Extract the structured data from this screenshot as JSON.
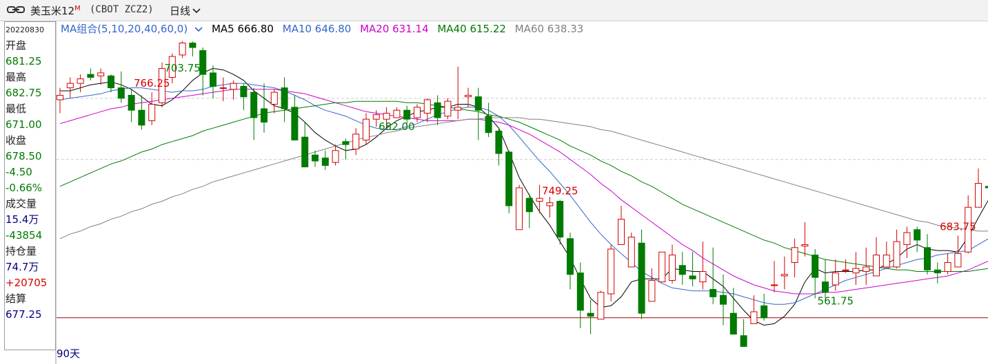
{
  "header": {
    "title": "美玉米12",
    "title_sup": "M",
    "code": "(CBOT ZCZ2)",
    "period": "日线"
  },
  "sidebar": {
    "date": "20220830",
    "open_label": "开盘",
    "open": "681.25",
    "high_label": "最高",
    "high": "682.75",
    "low_label": "最低",
    "low": "671.00",
    "close_label": "收盘",
    "close": "678.50",
    "change": "-4.50",
    "change_pct": "-0.66%",
    "volume_label": "成交量",
    "volume": "15.4万",
    "volume_change": "-43854",
    "oi_label": "持仓量",
    "oi": "74.7万",
    "oi_change": "+20705",
    "settle_label": "结算",
    "settle": "677.25"
  },
  "legend": {
    "group": "MA组合(5,10,20,40,60,0)",
    "ma5": "MA5 666.80",
    "ma10": "MA10 646.80",
    "ma20": "MA20 631.14",
    "ma40": "MA40 615.22",
    "ma60": "MA60 638.33"
  },
  "footer": {
    "days": "90天"
  },
  "colors": {
    "up": "#d40000",
    "down": "#007a00",
    "ma5": "#000000",
    "ma10": "#3366cc",
    "ma20": "#cc00cc",
    "ma40": "#007a00",
    "ma60": "#808080"
  },
  "chart_data": {
    "type": "candlestick",
    "ylim": [
      550,
      780
    ],
    "reference_levels": [
      728,
      687,
      581
    ],
    "annotations": [
      {
        "index": 9,
        "label": "766.25",
        "kind": "high"
      },
      {
        "index": 49,
        "label": "749.25",
        "kind": "high"
      },
      {
        "index": 12,
        "label": "703.75",
        "kind": "low"
      },
      {
        "index": 33,
        "label": "682.00",
        "kind": "low"
      },
      {
        "index": 76,
        "label": "561.75",
        "kind": "low"
      },
      {
        "index": 88,
        "label": "683.75",
        "kind": "high"
      }
    ],
    "candles": [
      [
        727,
        730,
        718,
        735
      ],
      [
        735,
        738,
        728,
        742
      ],
      [
        738,
        741,
        732,
        744
      ],
      [
        744,
        742,
        740,
        748
      ],
      [
        743,
        745,
        737,
        748
      ],
      [
        743,
        735,
        732,
        744
      ],
      [
        735,
        728,
        725,
        746
      ],
      [
        730,
        720,
        712,
        734
      ],
      [
        720,
        710,
        707,
        730
      ],
      [
        713,
        724,
        710,
        732
      ],
      [
        725,
        748,
        722,
        752
      ],
      [
        742,
        756,
        738,
        758
      ],
      [
        757,
        765,
        755,
        766.25
      ],
      [
        765,
        762,
        756,
        766
      ],
      [
        760,
        744,
        730,
        762
      ],
      [
        745,
        736,
        728,
        750
      ],
      [
        735,
        735,
        726,
        742
      ],
      [
        734,
        738,
        727,
        740
      ],
      [
        736,
        729,
        720,
        738
      ],
      [
        732,
        715,
        700,
        735
      ],
      [
        721,
        712,
        705,
        738
      ],
      [
        724,
        732,
        718,
        734
      ],
      [
        735,
        721,
        712,
        742
      ],
      [
        722,
        700,
        700,
        730
      ],
      [
        702,
        682,
        682,
        712
      ],
      [
        690,
        686,
        682,
        693
      ],
      [
        688,
        683,
        680,
        693
      ],
      [
        685,
        693,
        683,
        697
      ],
      [
        699,
        697,
        687,
        701
      ],
      [
        694,
        704,
        690,
        708
      ],
      [
        700,
        714,
        697,
        718
      ],
      [
        714,
        717,
        709,
        720
      ],
      [
        714,
        718,
        708,
        722
      ],
      [
        715,
        720,
        716,
        722
      ],
      [
        720,
        714,
        710,
        723
      ],
      [
        715,
        722,
        712,
        724
      ],
      [
        718,
        727,
        712,
        728
      ],
      [
        725,
        715,
        710,
        730
      ],
      [
        716,
        726,
        714,
        728
      ],
      [
        720,
        722,
        714,
        749.25
      ],
      [
        729,
        730,
        722,
        735
      ],
      [
        729,
        720,
        700,
        735
      ],
      [
        716,
        705,
        702,
        725
      ],
      [
        706,
        691,
        683,
        708
      ],
      [
        692,
        656,
        651,
        693
      ],
      [
        640,
        668,
        640,
        670
      ],
      [
        661,
        652,
        641,
        664
      ],
      [
        659,
        661,
        651,
        670
      ],
      [
        656,
        658,
        648,
        662
      ],
      [
        659,
        635,
        630,
        660
      ],
      [
        634,
        610,
        600,
        638
      ],
      [
        611,
        586,
        574,
        618
      ],
      [
        584,
        582,
        570,
        593
      ],
      [
        580,
        598,
        586,
        599
      ],
      [
        597,
        627,
        592,
        630
      ],
      [
        630,
        647,
        640,
        656
      ],
      [
        615,
        635,
        633,
        638
      ],
      [
        631,
        584,
        580,
        640
      ],
      [
        592,
        606,
        603,
        614
      ],
      [
        605,
        625,
        610,
        616
      ],
      [
        606,
        623,
        604,
        630
      ],
      [
        616,
        610,
        603,
        625
      ],
      [
        609,
        607,
        602,
        625
      ],
      [
        605,
        612,
        600,
        632
      ],
      [
        600,
        595,
        590,
        628
      ],
      [
        596,
        590,
        576,
        610
      ],
      [
        584,
        570,
        570,
        601
      ],
      [
        569,
        561.75,
        561.75,
        580
      ],
      [
        577,
        585,
        578,
        596
      ],
      [
        589,
        581,
        579,
        597
      ],
      [
        603,
        603,
        598,
        619
      ],
      [
        609,
        610,
        600,
        622
      ],
      [
        618,
        628,
        608,
        634
      ],
      [
        629,
        630,
        622,
        645
      ],
      [
        623,
        608,
        594,
        627
      ],
      [
        605,
        598,
        594,
        620
      ],
      [
        603,
        611,
        599,
        620
      ],
      [
        613,
        613,
        611,
        620
      ],
      [
        611,
        614,
        603,
        625
      ],
      [
        612,
        615,
        603,
        628
      ],
      [
        609,
        623,
        609,
        635
      ],
      [
        615,
        623,
        614,
        632
      ],
      [
        615,
        632,
        614,
        640
      ],
      [
        630,
        638,
        621,
        642
      ],
      [
        640,
        633,
        625,
        642
      ],
      [
        628,
        613,
        610,
        637
      ],
      [
        613,
        611,
        604,
        618
      ],
      [
        612,
        618,
        610,
        624
      ],
      [
        615,
        624,
        615,
        636
      ],
      [
        625,
        655,
        624,
        663
      ],
      [
        655,
        671,
        655,
        681
      ],
      [
        669,
        668,
        665,
        675
      ],
      [
        671,
        674,
        660,
        680
      ],
      [
        673,
        683.75,
        671,
        684
      ],
      [
        681.25,
        678.5,
        671,
        682.75
      ]
    ],
    "ma_series": [
      {
        "name": "MA5",
        "values": [
          733,
          733,
          735,
          737,
          738,
          739,
          737,
          734,
          729,
          724,
          723,
          727,
          733,
          740,
          745,
          748,
          747,
          744,
          740,
          733,
          728,
          723,
          721,
          718,
          712,
          705,
          700,
          696,
          693,
          694,
          697,
          702,
          708,
          713,
          716,
          719,
          720,
          722,
          722,
          724,
          724,
          722,
          716,
          708,
          692,
          675,
          663,
          652,
          643,
          632,
          621,
          607,
          594,
          588,
          589,
          595,
          605,
          607,
          607,
          607,
          614,
          613,
          612,
          612,
          607,
          602,
          594,
          586,
          579,
          576,
          577,
          582,
          590,
          605,
          614,
          611,
          612,
          612,
          612,
          613,
          613,
          617,
          621,
          627,
          630,
          627,
          626,
          626,
          625,
          635,
          648,
          660,
          668,
          667,
          666.8
        ]
      },
      {
        "name": "MA10",
        "values": [
          727,
          728,
          729,
          730,
          731,
          733,
          734,
          735,
          735,
          734,
          733,
          732,
          733,
          733,
          734,
          736,
          737,
          738,
          738,
          737,
          736,
          735,
          733,
          730,
          727,
          723,
          720,
          718,
          716,
          713,
          710,
          708,
          707,
          707,
          709,
          711,
          714,
          717,
          719,
          721,
          722,
          722,
          720,
          716,
          710,
          702,
          694,
          686,
          679,
          671,
          663,
          654,
          645,
          637,
          630,
          624,
          618,
          612,
          608,
          604,
          601,
          600,
          599,
          599,
          599,
          598,
          597,
          595,
          593,
          591,
          590,
          590,
          591,
          594,
          597,
          600,
          603,
          606,
          608,
          610,
          612,
          614,
          616,
          618,
          620,
          621,
          623,
          624,
          625,
          626,
          630,
          634,
          637,
          642,
          646.8
        ]
      },
      {
        "name": "MA20",
        "values": [
          711,
          713,
          715,
          717,
          719,
          721,
          722,
          724,
          725,
          726,
          727,
          728,
          729,
          730,
          731,
          732,
          733,
          734,
          734,
          734,
          734,
          734,
          733,
          732,
          731,
          729,
          727,
          725,
          723,
          721,
          719,
          718,
          717,
          716,
          715,
          714,
          713,
          713,
          713,
          713,
          714,
          714,
          713,
          712,
          710,
          707,
          704,
          700,
          696,
          692,
          687,
          682,
          677,
          671,
          666,
          660,
          655,
          650,
          645,
          640,
          635,
          630,
          626,
          621,
          617,
          613,
          609,
          606,
          603,
          601,
          599,
          598,
          597,
          597,
          597,
          598,
          598,
          599,
          600,
          601,
          602,
          603,
          604,
          605,
          606,
          607,
          608,
          609,
          611,
          613,
          616,
          619,
          623,
          627,
          631.14
        ]
      },
      {
        "name": "MA40",
        "values": [
          669,
          672,
          675,
          678,
          681,
          684,
          686,
          689,
          692,
          694,
          697,
          699,
          701,
          703,
          706,
          708,
          710,
          712,
          714,
          716,
          718,
          719,
          720,
          721,
          722,
          723,
          724,
          725,
          725,
          726,
          726,
          726,
          726,
          726,
          725,
          725,
          724,
          723,
          722,
          721,
          720,
          719,
          717,
          716,
          714,
          712,
          709,
          706,
          703,
          700,
          696,
          693,
          690,
          686,
          683,
          679,
          676,
          672,
          669,
          665,
          661,
          657,
          654,
          651,
          648,
          645,
          642,
          639,
          636,
          633,
          631,
          628,
          626,
          624,
          622,
          620,
          619,
          618,
          617,
          616,
          615,
          614,
          613,
          613,
          612,
          612,
          612,
          612,
          612,
          612,
          613,
          614,
          614,
          615,
          615.22
        ]
      },
      {
        "name": "MA60",
        "values": [
          634,
          637,
          639,
          642,
          644,
          647,
          649,
          652,
          654,
          657,
          659,
          662,
          664,
          667,
          669,
          672,
          674,
          676,
          678,
          680,
          682,
          684,
          686,
          688,
          690,
          692,
          694,
          696,
          698,
          700,
          702,
          703,
          705,
          706,
          708,
          709,
          710,
          711,
          712,
          713,
          714,
          714,
          715,
          715,
          715,
          715,
          714,
          714,
          713,
          712,
          711,
          710,
          709,
          707,
          706,
          704,
          702,
          700,
          698,
          696,
          694,
          692,
          690,
          688,
          686,
          684,
          682,
          680,
          678,
          676,
          674,
          672,
          670,
          668,
          666,
          664,
          662,
          660,
          658,
          656,
          654,
          652,
          650,
          648,
          646,
          645,
          643,
          642,
          641,
          640,
          639,
          639,
          638,
          638,
          638.33
        ]
      }
    ]
  }
}
